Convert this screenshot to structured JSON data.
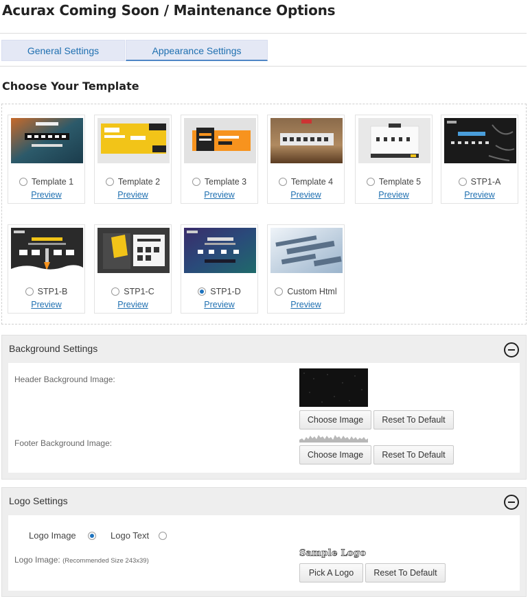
{
  "page": {
    "title": "Acurax Coming Soon / Maintenance Options"
  },
  "tabs": [
    {
      "label": "General Settings"
    },
    {
      "label": "Appearance Settings"
    }
  ],
  "templates": {
    "heading": "Choose Your Template",
    "preview_label": "Preview",
    "selected": "STP1-D",
    "items": [
      {
        "label": "Template 1",
        "checked": false
      },
      {
        "label": "Template 2",
        "checked": false
      },
      {
        "label": "Template 3",
        "checked": false
      },
      {
        "label": "Template 4",
        "checked": false
      },
      {
        "label": "Template 5",
        "checked": false
      },
      {
        "label": "STP1-A",
        "checked": false
      },
      {
        "label": "STP1-B",
        "checked": false
      },
      {
        "label": "STP1-C",
        "checked": false
      },
      {
        "label": "STP1-D",
        "checked": true
      },
      {
        "label": "Custom Html",
        "checked": false
      }
    ]
  },
  "background": {
    "title": "Background Settings",
    "header_label": "Header Background Image:",
    "footer_label": "Footer Background Image:",
    "choose_label": "Choose Image",
    "reset_label": "Reset To Default"
  },
  "logo": {
    "title": "Logo Settings",
    "option_image": "Logo Image",
    "option_text": "Logo Text",
    "selected_option": "Logo Image",
    "image_label": "Logo Image:",
    "recommended": "(Recommended Size 243x39)",
    "sample_text": "Sample Logo",
    "pick_label": "Pick A Logo",
    "reset_label": "Reset To Default"
  },
  "colors": {
    "link": "#1e6fb0",
    "tab_bg": "#e4e8f5",
    "radio_checked": "#1e73be",
    "panel_bg": "#eeeeee"
  }
}
